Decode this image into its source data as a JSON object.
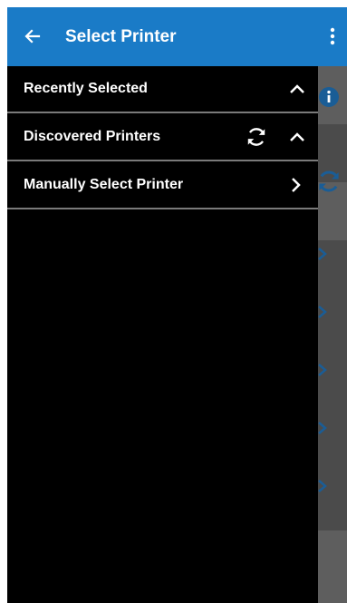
{
  "appbar": {
    "title": "Select Printer",
    "back_icon": "arrow-left-icon",
    "menu_icon": "more-vert-icon",
    "color": "#1a7bc7"
  },
  "drawer": {
    "items": [
      {
        "label": "Recently Selected",
        "icons": [
          "chevron-up-icon"
        ]
      },
      {
        "label": "Discovered Printers",
        "icons": [
          "refresh-icon",
          "chevron-up-icon"
        ]
      },
      {
        "label": "Manually Select Printer",
        "icons": [
          "chevron-right-icon"
        ]
      }
    ],
    "background": "#000000",
    "divider_color": "#7a7a7a"
  },
  "background_content": {
    "icons": [
      "info-icon",
      "refresh-icon",
      "chevron-right-icon"
    ]
  }
}
